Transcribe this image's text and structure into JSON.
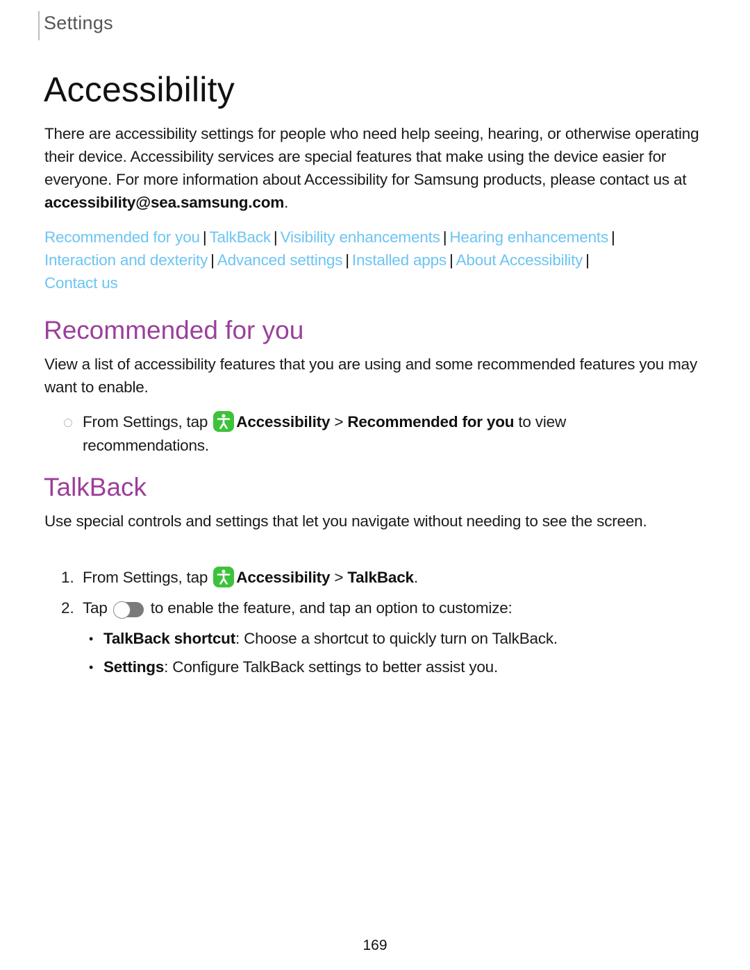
{
  "header": {
    "section_label": "Settings"
  },
  "title": "Accessibility",
  "intro": {
    "text": "There are accessibility settings for people who need help seeing, hearing, or otherwise operating their device. Accessibility services are special features that make using the device easier for everyone. For more information about Accessibility for Samsung products, please contact us at ",
    "email": "accessibility@sea.samsung.com",
    "end": "."
  },
  "links": {
    "items": [
      "Recommended for you",
      "TalkBack",
      "Visibility enhancements",
      "Hearing enhancements",
      "Interaction and dexterity",
      "Advanced settings",
      "Installed apps",
      "About Accessibility",
      "Contact us"
    ],
    "separator": "|",
    "color": "#6cc4f3"
  },
  "recommended": {
    "heading": "Recommended for you",
    "description": "View a list of accessibility features that you are using and some recommended features you may want to enable.",
    "step": {
      "prefix": "From Settings, tap ",
      "icon": "accessibility-icon",
      "bold1": "Accessibility",
      "arrow": " > ",
      "bold2": "Recommended for you",
      "suffix": " to view recommendations."
    }
  },
  "talkback": {
    "heading": "TalkBack",
    "description": "Use special controls and settings that let you navigate without needing to see the screen.",
    "steps": [
      {
        "num": "1.",
        "prefix": "From Settings, tap ",
        "icon": "accessibility-icon",
        "bold1": "Accessibility",
        "arrow": " > ",
        "bold2": "TalkBack",
        "suffix": "."
      },
      {
        "num": "2.",
        "prefix": "Tap ",
        "icon": "toggle-icon",
        "suffix": " to enable the feature, and tap an option to customize:"
      }
    ],
    "options": [
      {
        "bullet": "•",
        "label": "TalkBack shortcut",
        "text": ": Choose a shortcut to quickly turn on TalkBack."
      },
      {
        "bullet": "•",
        "label": "Settings",
        "text": ": Configure TalkBack settings to better assist you."
      }
    ]
  },
  "colors": {
    "heading": "#9b3f9b",
    "link": "#6cc4f3",
    "icon_green": "#3ec23a"
  },
  "page_number": "169"
}
